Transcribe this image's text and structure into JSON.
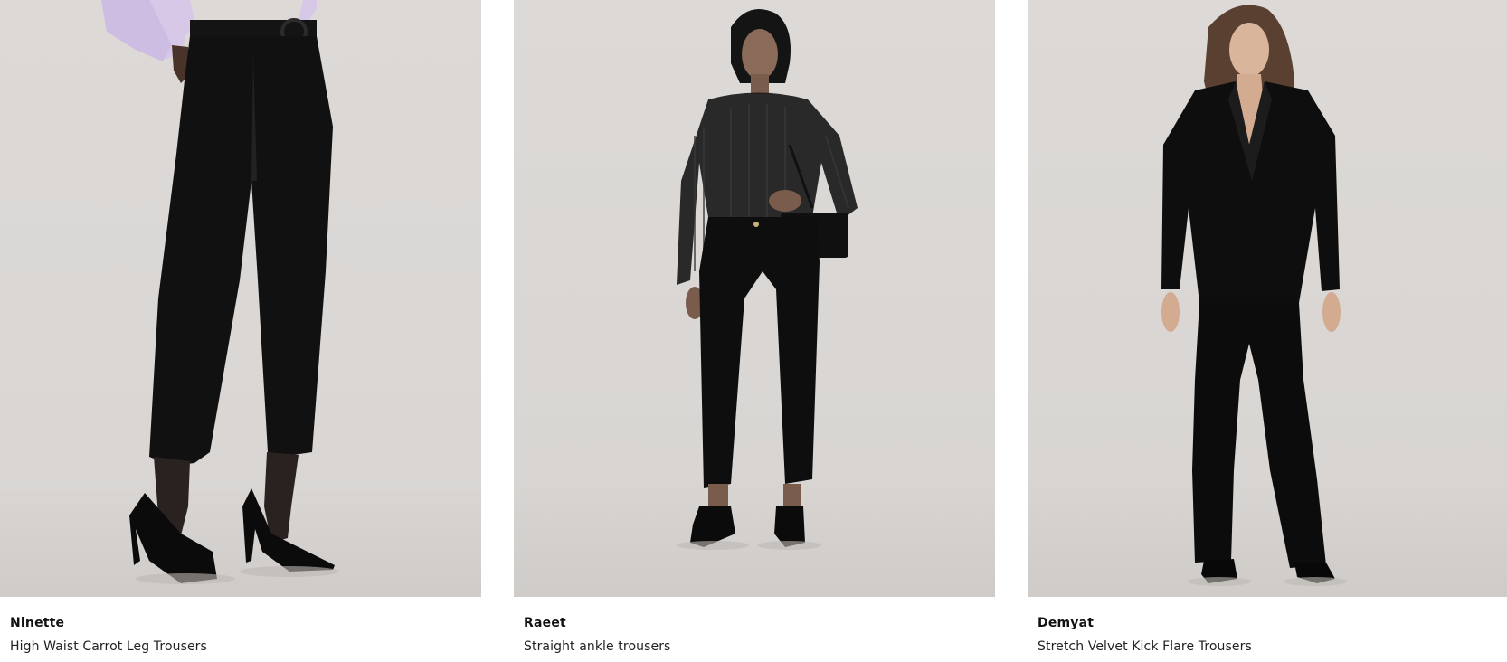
{
  "products": [
    {
      "name": "Ninette",
      "description": "High Waist Carrot Leg Trousers"
    },
    {
      "name": "Raeet",
      "description": "Straight ankle trousers"
    },
    {
      "name": "Demyat",
      "description": "Stretch Velvet Kick Flare Trousers"
    }
  ]
}
